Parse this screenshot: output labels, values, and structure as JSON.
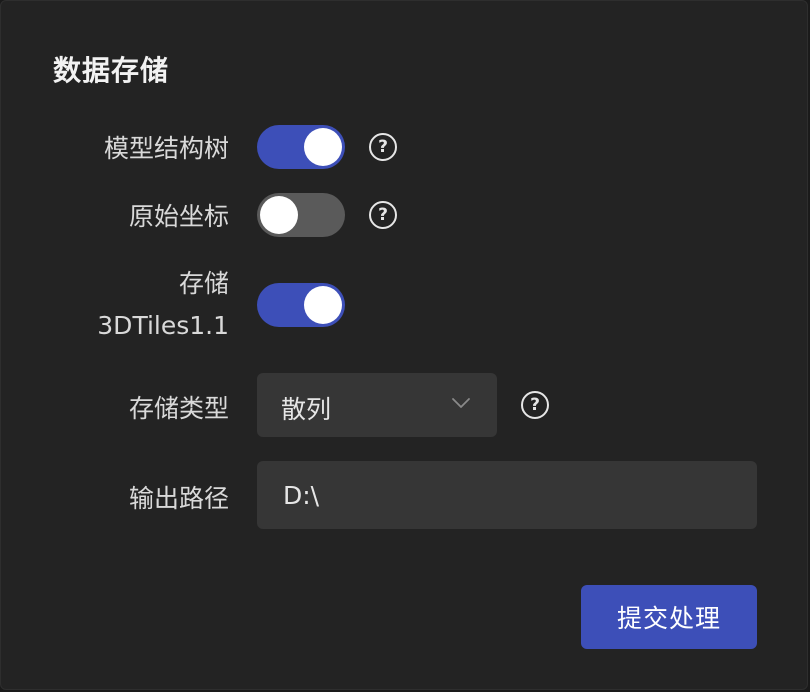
{
  "panel": {
    "title": "数据存储"
  },
  "rows": {
    "model_tree": {
      "label": "模型结构树",
      "enabled": true
    },
    "original_coords": {
      "label": "原始坐标",
      "enabled": false
    },
    "store_3dtiles": {
      "label_line1": "存储",
      "label_line2": "3DTiles1.1",
      "enabled": true
    },
    "storage_type": {
      "label": "存储类型",
      "selected": "散列"
    },
    "output_path": {
      "label": "输出路径",
      "value": "D:\\"
    }
  },
  "help_glyph": "?",
  "submit_label": "提交处理",
  "colors": {
    "accent": "#3d4fb8",
    "toggle_off": "#5a5a5a",
    "panel_bg": "#232323",
    "field_bg": "#363636"
  },
  "icons": [
    "help-icon",
    "chevron-down-icon"
  ]
}
